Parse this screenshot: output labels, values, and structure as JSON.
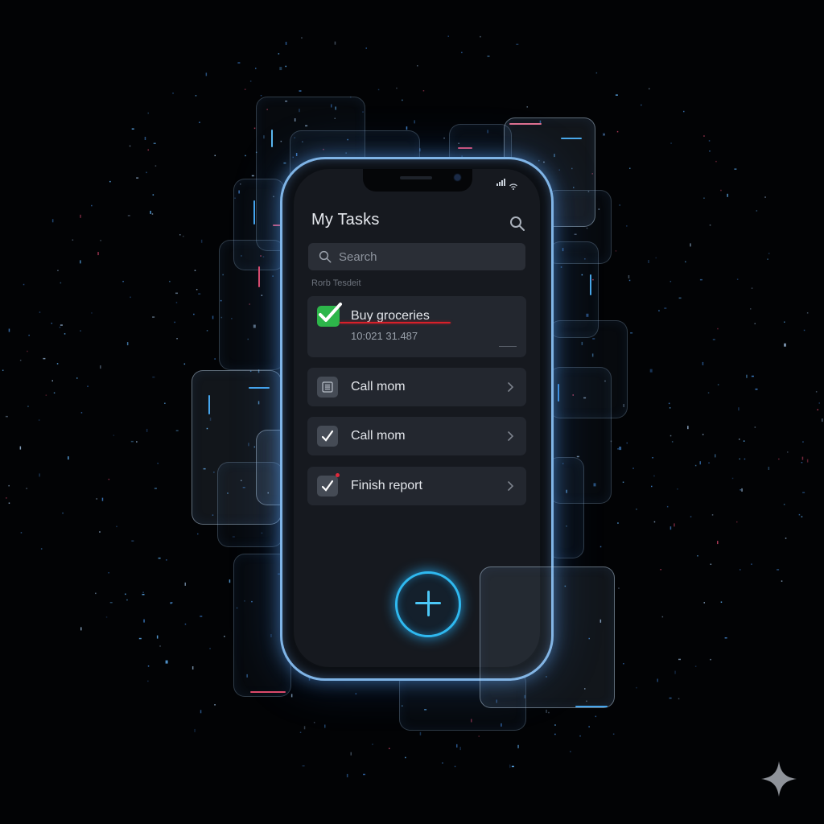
{
  "app": {
    "title": "My Tasks",
    "search_placeholder": "Search",
    "section_label": "Rorb Tesdeit"
  },
  "tasks": [
    {
      "name": "Buy groceries",
      "time": "10:021 31.487",
      "completed": true,
      "icon": "check-icon"
    },
    {
      "name": "Call mom",
      "icon": "list-icon"
    },
    {
      "name": "Call mom",
      "icon": "check-icon"
    },
    {
      "name": "Finish report",
      "icon": "check-icon"
    }
  ],
  "icons": {
    "search": "search-icon",
    "chevron": "chevron-right-icon",
    "add": "plus-icon",
    "watermark": "sparkle-icon"
  },
  "colors": {
    "background": "#020305",
    "phone_glow": "#7fb4e6",
    "fab_accent": "#2fb9f0",
    "completed_check": "#2db64a",
    "strike_line": "#d8202a",
    "accent_pink": "#e0283a"
  }
}
